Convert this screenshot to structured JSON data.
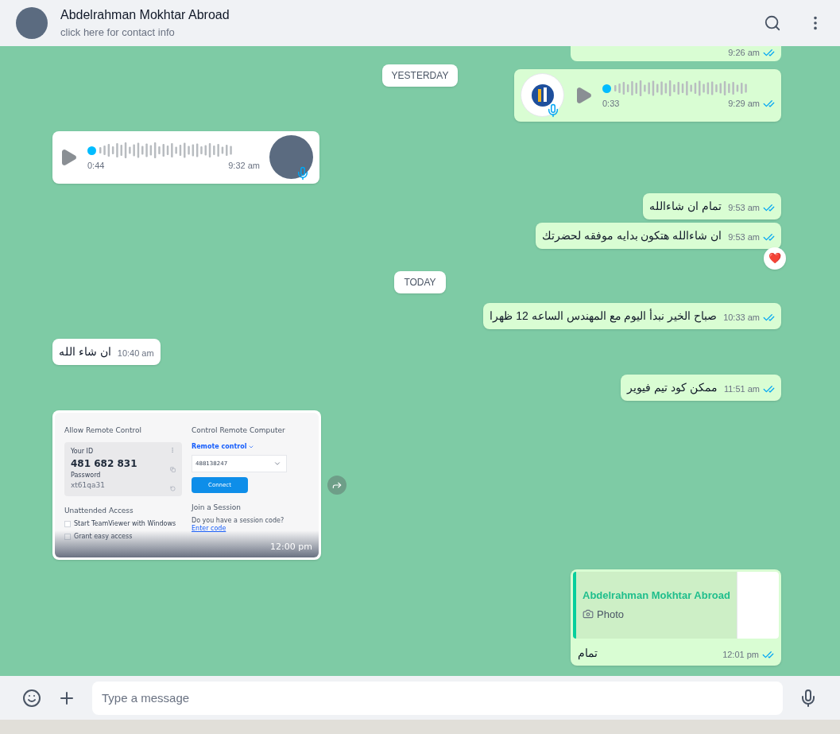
{
  "header": {
    "name": "Abdelrahman Mokhtar Abroad",
    "subtitle": "click here for contact info"
  },
  "messages": [
    {
      "kind": "partial",
      "outgoing": true,
      "time": "9:26 am",
      "read": true
    },
    {
      "kind": "date",
      "text": "YESTERDAY"
    },
    {
      "kind": "voice",
      "outgoing": true,
      "avatar": {
        "kind": "logo"
      },
      "duration": "0:33",
      "time": "9:29 am",
      "read": true
    },
    {
      "kind": "voice",
      "outgoing": false,
      "avatar": {
        "kind": "photo"
      },
      "duration": "0:44",
      "time": "9:32 am"
    },
    {
      "kind": "text",
      "outgoing": true,
      "text": "تمام ان شاءالله",
      "time": "9:53 am",
      "read": true
    },
    {
      "kind": "text",
      "outgoing": true,
      "text": "ان شاءالله هتكون بدايه موفقه لحضرتك",
      "time": "9:53 am",
      "read": true,
      "reaction": "❤️"
    },
    {
      "kind": "date",
      "text": "TODAY"
    },
    {
      "kind": "text",
      "outgoing": true,
      "text": "صباح الخير نبدأ اليوم مع المهندس الساعه 12 ظهرا",
      "time": "10:33 am",
      "read": true
    },
    {
      "kind": "text",
      "outgoing": false,
      "text": "ان شاء الله",
      "time": "10:40 am"
    },
    {
      "kind": "text",
      "outgoing": true,
      "text": "ممكن كود تيم فيوير",
      "time": "11:51 am",
      "read": true
    },
    {
      "kind": "image",
      "outgoing": false,
      "time": "12:00 pm",
      "screenshot": {
        "left_title": "Allow Remote Control",
        "id_label": "Your ID",
        "id_value": "481 682 831",
        "password_label": "Password",
        "password_value": "xt61qa31",
        "unattended_title": "Unattended Access",
        "options": [
          {
            "label": "Start TeamViewer with Windows",
            "checked": false
          },
          {
            "label": "Grant easy access",
            "checked": false
          }
        ],
        "right_title": "Control Remote Computer",
        "mode": "Remote control",
        "partner_id": "488138247",
        "connect": "Connect",
        "join_title": "Join a Session",
        "join_text": "Do you have a session code?",
        "join_link": "Enter code"
      }
    },
    {
      "kind": "reply",
      "outgoing": true,
      "quote_name": "Abdelrahman Mokhtar Abroad",
      "quote_type": "Photo",
      "text": "تمام",
      "time": "12:01 pm",
      "read": true
    }
  ],
  "composer": {
    "placeholder": "Type a message"
  }
}
